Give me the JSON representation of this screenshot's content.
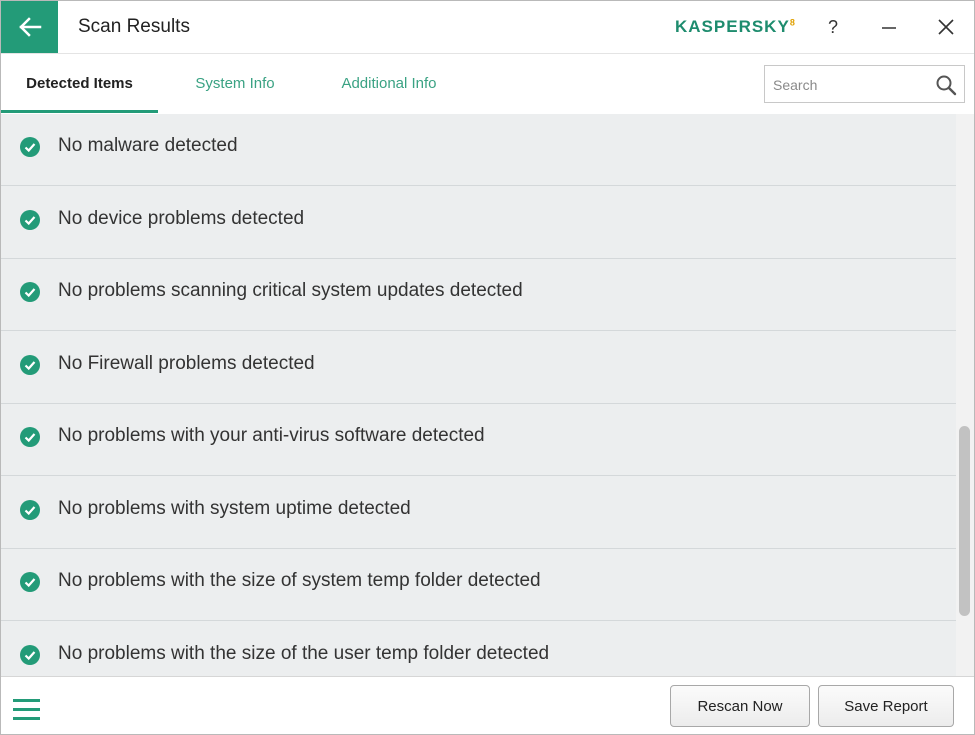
{
  "window": {
    "title": "Scan Results",
    "brand": "KASPERSKY",
    "brand_mark": "8",
    "help_label": "?"
  },
  "tabs": [
    {
      "label": "Detected Items",
      "active": true
    },
    {
      "label": "System Info",
      "active": false
    },
    {
      "label": "Additional Info",
      "active": false
    }
  ],
  "search": {
    "placeholder": "Search",
    "value": ""
  },
  "results": [
    {
      "label": "No malware detected",
      "status": "ok"
    },
    {
      "label": "No device problems detected",
      "status": "ok"
    },
    {
      "label": "No problems scanning critical system updates detected",
      "status": "ok"
    },
    {
      "label": "No Firewall problems detected",
      "status": "ok"
    },
    {
      "label": "No problems with your anti-virus software detected",
      "status": "ok"
    },
    {
      "label": "No problems with system uptime detected",
      "status": "ok"
    },
    {
      "label": "No problems with the size of system temp folder detected",
      "status": "ok"
    },
    {
      "label": "No problems with the size of the user temp folder detected",
      "status": "ok"
    }
  ],
  "footer": {
    "rescan_label": "Rescan Now",
    "save_label": "Save Report"
  },
  "colors": {
    "accent": "#239b78",
    "tab_inactive": "#3aa283",
    "list_bg": "#eceeef"
  },
  "icons": {
    "back": "arrow-left-icon",
    "check": "check-circle-icon",
    "search": "search-icon",
    "menu": "hamburger-menu-icon"
  }
}
